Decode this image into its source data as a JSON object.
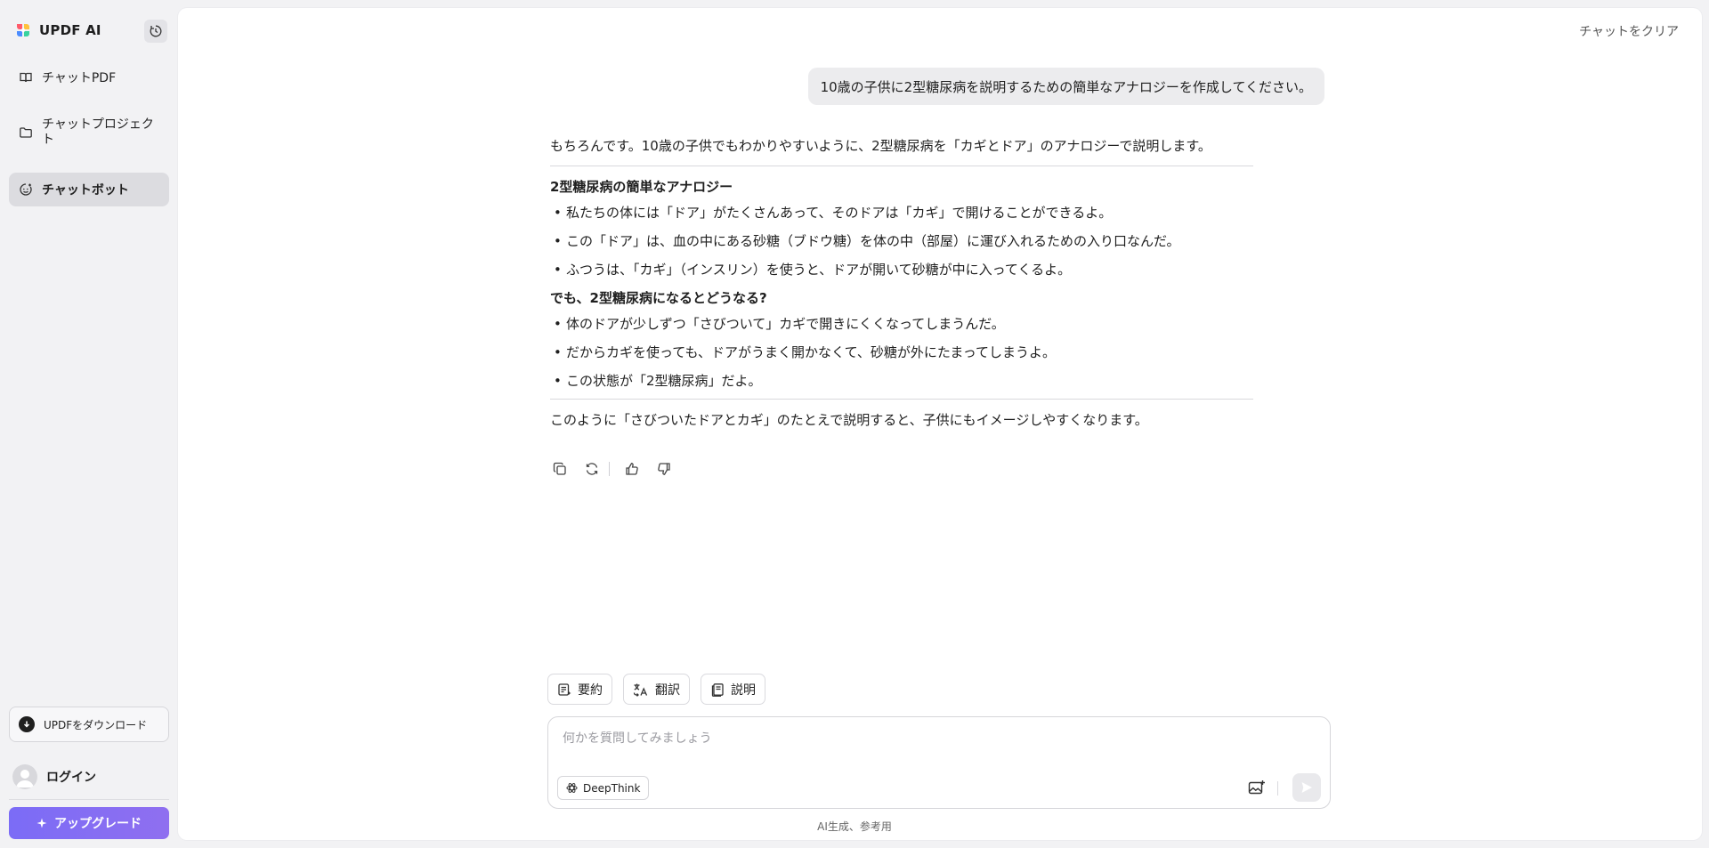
{
  "brand": {
    "name": "UPDF AI"
  },
  "sidebar": {
    "items": [
      {
        "label": "チャットPDF",
        "icon": "book-icon"
      },
      {
        "label": "チャットプロジェクト",
        "icon": "folder-icon"
      },
      {
        "label": "チャットボット",
        "icon": "bot-icon",
        "active": true
      }
    ],
    "download_label": "UPDFをダウンロード",
    "login_label": "ログイン",
    "upgrade_label": "アップグレード"
  },
  "header": {
    "clear_label": "チャットをクリア"
  },
  "chat": {
    "user_message": "10歳の子供に2型糖尿病を説明するための簡単なアナロジーを作成してください。",
    "answer": {
      "intro": "もちろんです。10歳の子供でもわかりやすいように、2型糖尿病を「カギとドア」のアナロジーで説明します。",
      "section1_title": "2型糖尿病の簡単なアナロジー",
      "section1_items": [
        "私たちの体には「ドア」がたくさんあって、そのドアは「カギ」で開けることができるよ。",
        "この「ドア」は、血の中にある砂糖（ブドウ糖）を体の中（部屋）に運び入れるための入り口なんだ。",
        "ふつうは、「カギ」（インスリン）を使うと、ドアが開いて砂糖が中に入ってくるよ。"
      ],
      "section2_title": "でも、2型糖尿病になるとどうなる?",
      "section2_items": [
        "体のドアが少しずつ「さびついて」カギで開きにくくなってしまうんだ。",
        "だからカギを使っても、ドアがうまく開かなくて、砂糖が外にたまってしまうよ。",
        "この状態が「2型糖尿病」だよ。"
      ],
      "outro": "このように「さびついたドアとカギ」のたとえで説明すると、子供にもイメージしやすくなります。"
    }
  },
  "quick_actions": [
    {
      "label": "要約",
      "icon": "summary-icon"
    },
    {
      "label": "翻訳",
      "icon": "translate-icon"
    },
    {
      "label": "説明",
      "icon": "explain-icon"
    }
  ],
  "composer": {
    "placeholder": "何かを質問してみましょう",
    "deepthink_label": "DeepThink"
  },
  "footer": {
    "note": "AI生成、参考用"
  },
  "colors": {
    "accent": "#7b6cf6",
    "bubble": "#ececee",
    "sidebar_bg": "#f2f2f4"
  }
}
